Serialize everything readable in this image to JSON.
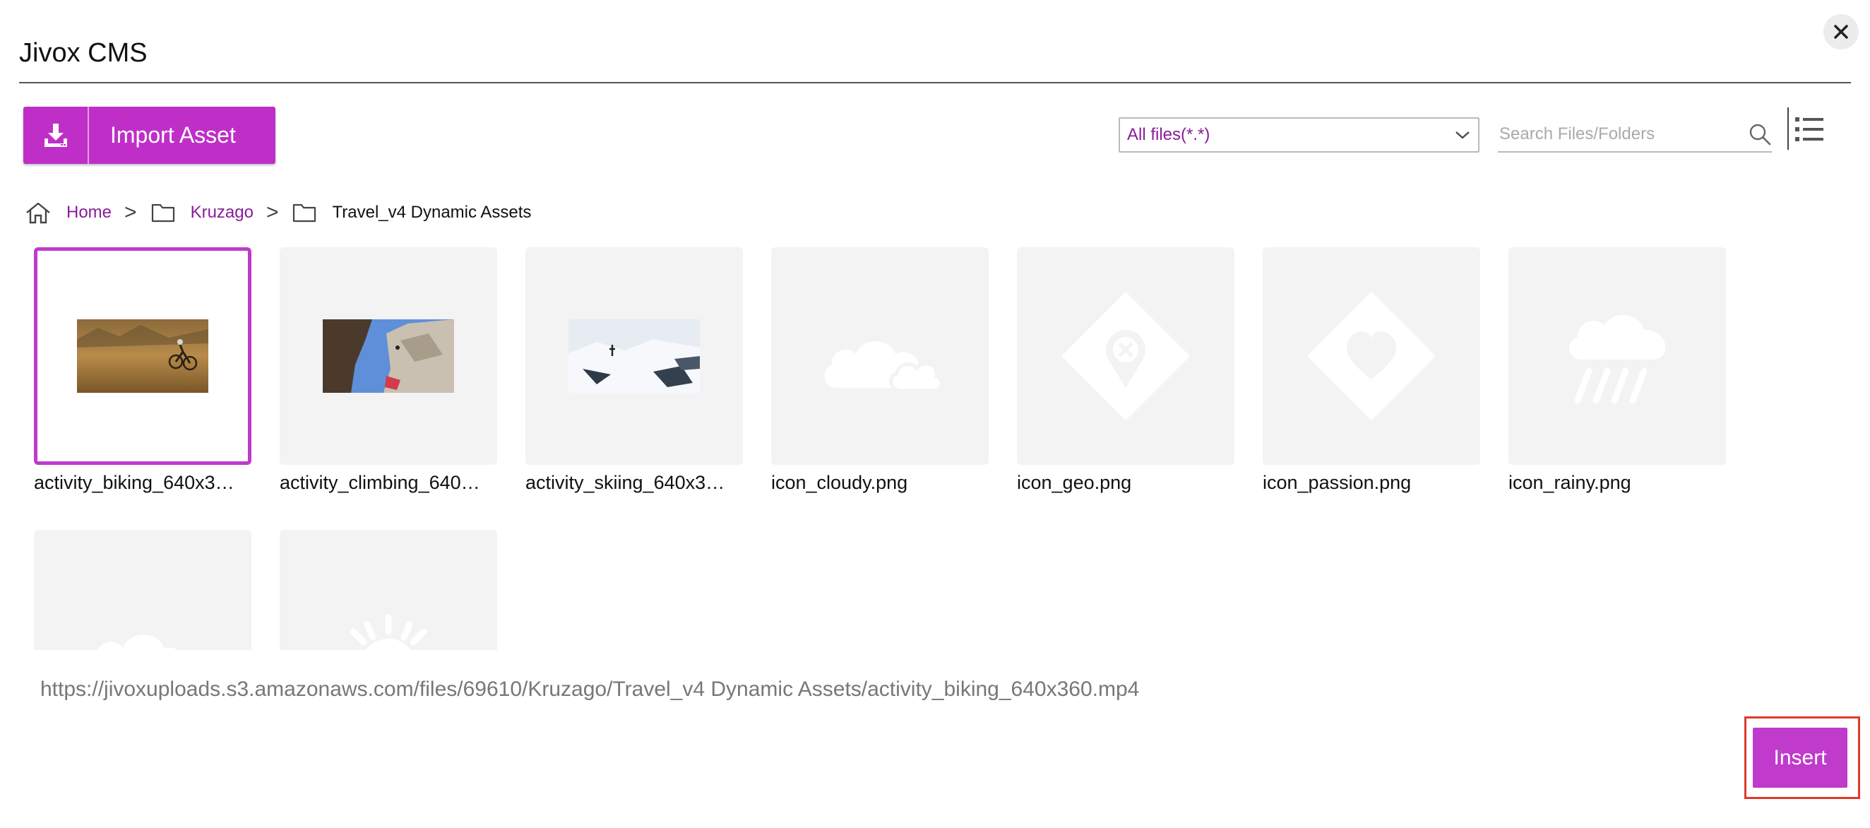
{
  "app": {
    "title": "Jivox CMS"
  },
  "toolbar": {
    "import_label": "Import Asset",
    "filter_selected": "All files(*.*)",
    "search_placeholder": "Search Files/Folders"
  },
  "breadcrumb": {
    "home": "Home",
    "folder": "Kruzago",
    "current": "Travel_v4 Dynamic Assets",
    "separator": ">"
  },
  "files": [
    {
      "name": "activity_biking_640x3…",
      "icon": "biking-photo-thumbnail",
      "selected": true
    },
    {
      "name": "activity_climbing_640…",
      "icon": "climbing-photo-thumbnail"
    },
    {
      "name": "activity_skiing_640x3…",
      "icon": "skiing-photo-thumbnail"
    },
    {
      "name": "icon_cloudy.png",
      "icon": "cloud-icon"
    },
    {
      "name": "icon_geo.png",
      "icon": "geo-pin-icon"
    },
    {
      "name": "icon_passion.png",
      "icon": "heart-icon"
    },
    {
      "name": "icon_rainy.png",
      "icon": "rain-cloud-icon"
    },
    {
      "name": "",
      "icon": "snow-cloud-icon"
    },
    {
      "name": "",
      "icon": "sun-icon"
    }
  ],
  "selected_url": "https://jivoxuploads.s3.amazonaws.com/files/69610/Kruzago/Travel_v4 Dynamic Assets/activity_biking_640x360.mp4",
  "actions": {
    "insert_label": "Insert"
  },
  "colors": {
    "accent": "#bf2fc8",
    "link": "#8a1c9a",
    "highlight_frame": "#e03a2a",
    "tile_bg": "#f3f3f3"
  }
}
